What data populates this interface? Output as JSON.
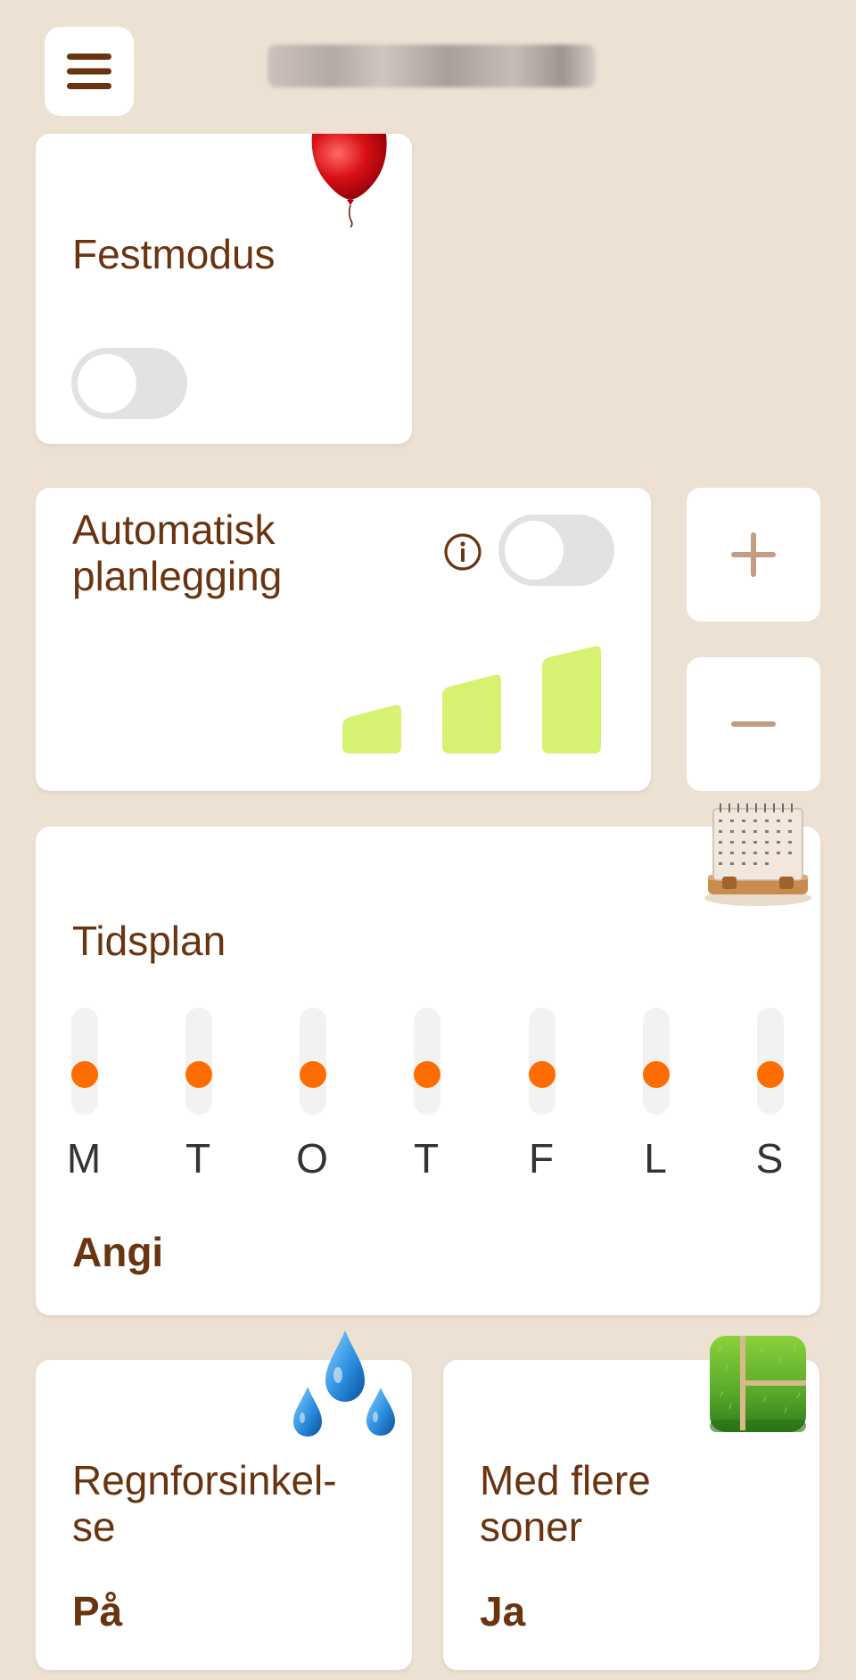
{
  "header": {
    "menu_icon": "hamburger-menu-icon",
    "title_obscured": true
  },
  "party_mode": {
    "title": "Festmodus",
    "icon": "balloon-icon",
    "enabled": false
  },
  "auto_planning": {
    "title_line1": "Automatisk",
    "title_line2": "planlegging",
    "info_icon": "info-icon",
    "enabled": false,
    "level_icon": "signal-bars-icon",
    "bar_color": "#d7f171"
  },
  "adjust": {
    "plus_icon": "plus-icon",
    "minus_icon": "minus-icon"
  },
  "schedule": {
    "title": "Tidsplan",
    "icon": "desk-calendar-icon",
    "days": [
      "M",
      "T",
      "O",
      "T",
      "F",
      "L",
      "S"
    ],
    "dot_color": "#ff6d00",
    "action_label": "Angi"
  },
  "rain_delay": {
    "title_line1": "Regnforsinkel-",
    "title_line2": "se",
    "value": "På",
    "icon": "raindrops-icon"
  },
  "multi_zone": {
    "title_line1": "Med flere",
    "title_line2": "soner",
    "value": "Ja",
    "icon": "lawn-zones-icon"
  }
}
